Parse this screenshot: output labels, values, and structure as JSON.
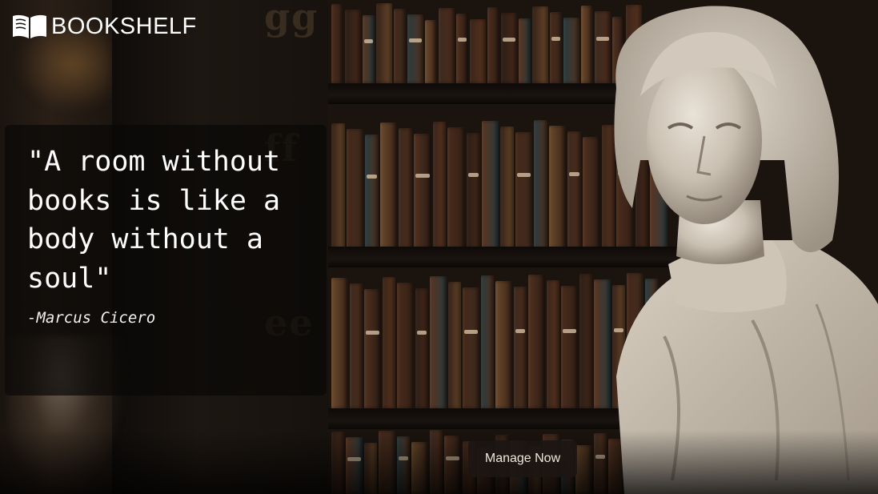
{
  "brand": {
    "name": "BOOKSHELF",
    "icon": "open-book-icon"
  },
  "quote": {
    "text": "\"A room without books is like a body without a soul\"",
    "author": "-Marcus Cicero"
  },
  "cta": {
    "label": "Manage Now"
  },
  "colors": {
    "background": "#120d0a",
    "card_overlay": "#0a0807",
    "text": "#ffffff",
    "button_bg": "#1c1612",
    "button_text": "#efe7dd"
  },
  "decor": {
    "pillar_letters": [
      "gg",
      "ff",
      "ee"
    ]
  }
}
